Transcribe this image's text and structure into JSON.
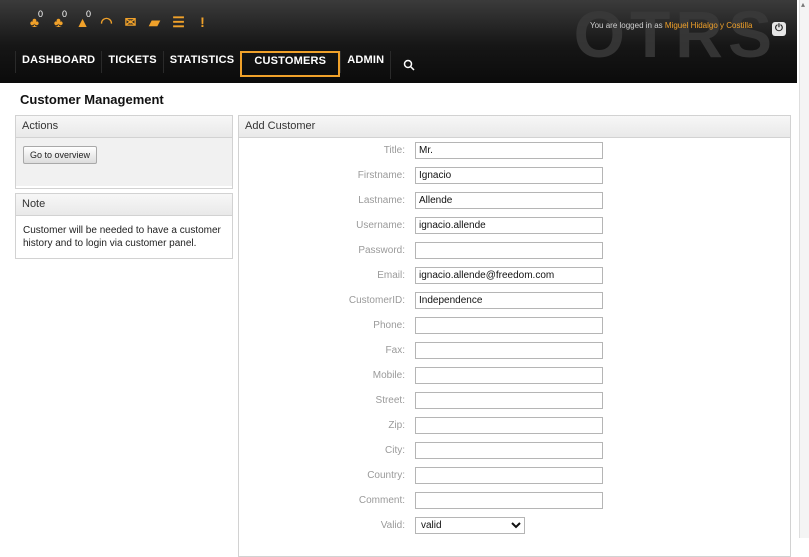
{
  "header": {
    "brand": "OTRS",
    "login_prefix": "You are logged in as",
    "login_user": "Miguel Hidalgo y Costilla",
    "toolbar": [
      {
        "name": "locked-tickets-icon",
        "glyph": "♣",
        "count": "0"
      },
      {
        "name": "watched-tickets-icon",
        "glyph": "♣",
        "count": "0"
      },
      {
        "name": "responsible-tickets-icon",
        "glyph": "▲",
        "count": "0"
      },
      {
        "name": "phone-ticket-icon",
        "glyph": "◠",
        "count": ""
      },
      {
        "name": "email-ticket-icon",
        "glyph": "✉",
        "count": ""
      },
      {
        "name": "open-folder-icon",
        "glyph": "▰",
        "count": ""
      },
      {
        "name": "list-icon",
        "glyph": "☰",
        "count": ""
      },
      {
        "name": "escalation-icon",
        "glyph": "!",
        "count": ""
      }
    ],
    "nav": [
      "DASHBOARD",
      "TICKETS",
      "STATISTICS",
      "CUSTOMERS",
      "ADMIN"
    ],
    "active_nav": "CUSTOMERS"
  },
  "page": {
    "title": "Customer Management"
  },
  "actions": {
    "heading": "Actions",
    "overview_button": "Go to overview"
  },
  "note": {
    "heading": "Note",
    "text": "Customer will be needed to have a customer history and to login via customer panel."
  },
  "form": {
    "heading": "Add Customer",
    "fields": [
      {
        "label": "Title:",
        "value": ""
      },
      {
        "label": "Firstname:",
        "value": "Ignacio"
      },
      {
        "label": "Lastname:",
        "value": "Allende"
      },
      {
        "label": "Username:",
        "value": "ignacio.allende"
      },
      {
        "label": "Password:",
        "value": ""
      },
      {
        "label": "Email:",
        "value": "ignacio.allende@freedom.com"
      },
      {
        "label": "CustomerID:",
        "value": "Independence"
      },
      {
        "label": "Phone:",
        "value": ""
      },
      {
        "label": "Fax:",
        "value": ""
      },
      {
        "label": "Mobile:",
        "value": ""
      },
      {
        "label": "Street:",
        "value": ""
      },
      {
        "label": "Zip:",
        "value": ""
      },
      {
        "label": "City:",
        "value": ""
      },
      {
        "label": "Country:",
        "value": ""
      },
      {
        "label": "Comment:",
        "value": ""
      }
    ],
    "title_value": "Mr.",
    "valid_label": "Valid:",
    "valid_selected": "valid"
  },
  "colors": {
    "accent": "#f0a12a",
    "header_dark": "#161616"
  }
}
